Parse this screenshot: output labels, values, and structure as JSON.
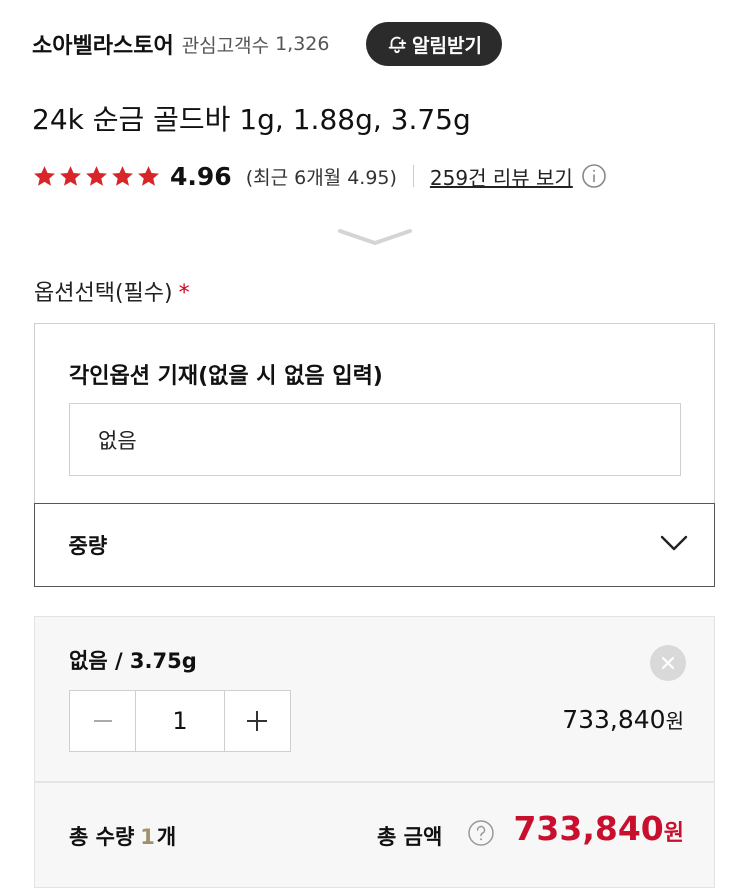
{
  "store": {
    "name": "소아벨라스토어",
    "follower_label": "관심고객수",
    "follower_count": "1,326",
    "alarm_label": "알림받기"
  },
  "product": {
    "title": "24k 순금 골드바 1g, 1.88g, 3.75g",
    "rating": "4.96",
    "recent_rating_text": "(최근 6개월 4.95)",
    "review_link": "259건 리뷰 보기",
    "stars": 5
  },
  "options": {
    "section_label": "옵션선택(필수)",
    "required_mark": "*",
    "engrave_label": "각인옵션 기재(없을 시 없음 입력)",
    "engrave_value": "없음",
    "weight_label": "중량"
  },
  "selected": {
    "name": "없음 / 3.75g",
    "quantity": "1",
    "price": "733,840",
    "currency": "원"
  },
  "total": {
    "qty_label": "총 수량",
    "qty": "1",
    "qty_unit": "개",
    "price_label": "총 금액",
    "price": "733,840",
    "currency": "원"
  },
  "colors": {
    "star": "#d7262a",
    "price": "#c8102e",
    "qty_accent": "#a0916b",
    "alarm_bg": "#2b2b2b"
  },
  "icons": [
    "bell-plus-icon",
    "star-icon",
    "info-icon",
    "sheet-handle-icon",
    "chevron-down-icon",
    "close-icon",
    "minus-icon",
    "plus-icon",
    "help-icon"
  ]
}
